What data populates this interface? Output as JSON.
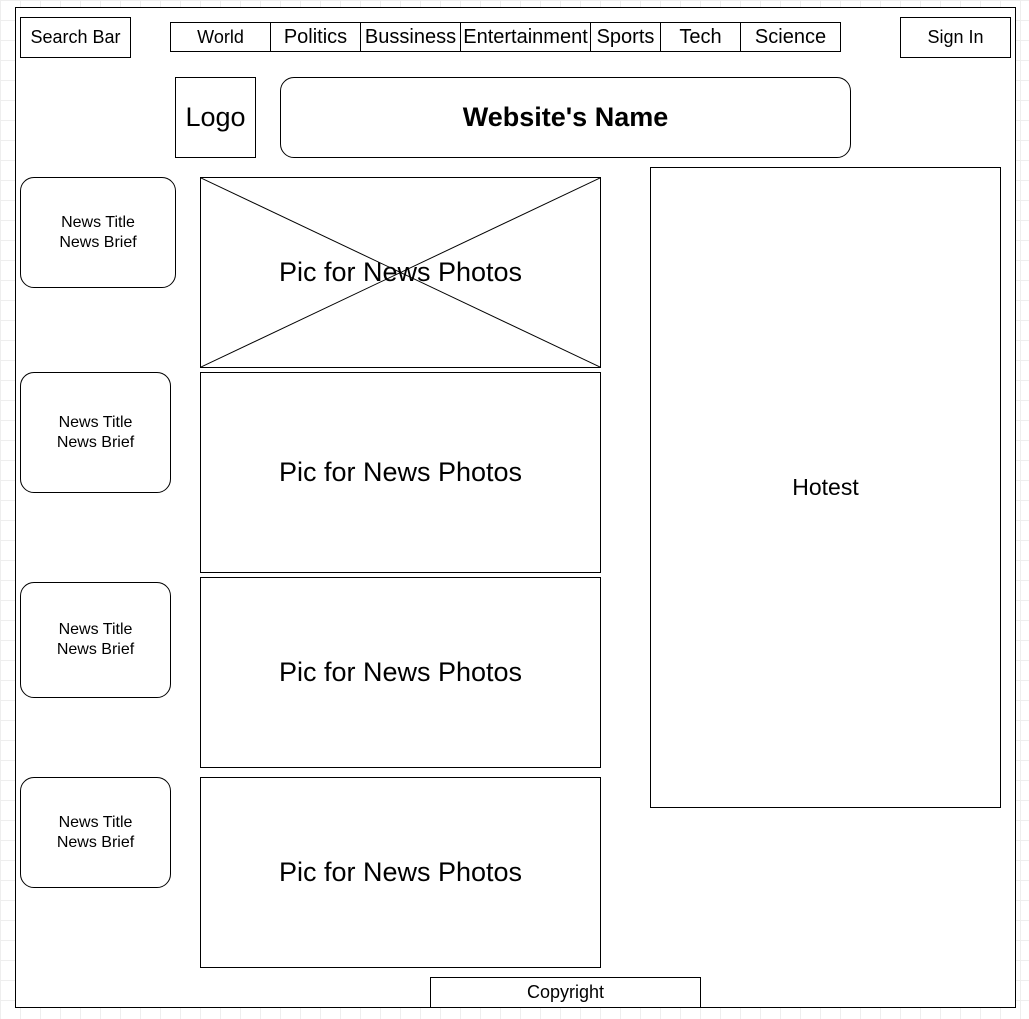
{
  "header": {
    "search_label": "Search Bar",
    "nav": [
      "World",
      "Politics",
      "Bussiness",
      "Entertainment",
      "Sports",
      "Tech",
      "Science"
    ],
    "signin_label": "Sign In"
  },
  "branding": {
    "logo_label": "Logo",
    "site_name": "Website's Name"
  },
  "news": [
    {
      "title": "News Title",
      "brief": "News Brief",
      "photo": "Pic for News Photos"
    },
    {
      "title": "News Title",
      "brief": "News Brief",
      "photo": "Pic for News Photos"
    },
    {
      "title": "News Title",
      "brief": "News Brief",
      "photo": "Pic for News Photos"
    },
    {
      "title": "News Title",
      "brief": "News Brief",
      "photo": "Pic for News Photos"
    }
  ],
  "sidebar": {
    "hottest_label": "Hotest"
  },
  "footer": {
    "copyright_label": "Copyright"
  }
}
